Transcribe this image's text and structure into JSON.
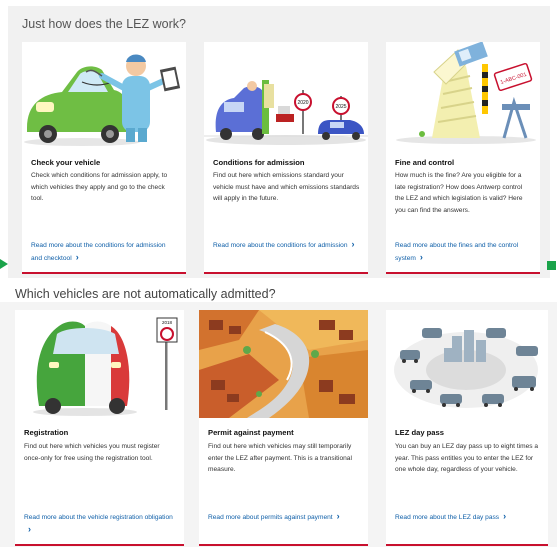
{
  "sections": {
    "work_heading": "Just how does the LEZ work?",
    "vehicles_heading": "Which vehicles are not automatically admitted?"
  },
  "cards_top": [
    {
      "title": "Check your vehicle",
      "description": "Check which conditions for admission apply, to which vehicles they apply and go to the check tool.",
      "link": "Read more about the conditions for admission and checktool",
      "image": "mechanic-inspecting-car-illustration"
    },
    {
      "title": "Conditions for admission",
      "description": "Find out here which emissions standard your vehicle must have and which emissions standards will apply in the future.",
      "link": "Read more about the conditions for admission",
      "image": "cars-passing-emission-signs-illustration",
      "signs": [
        "2020",
        "2025"
      ]
    },
    {
      "title": "Fine and control",
      "description": "How much is the fine? Are you eligible for a late registration? How does Antwerp control the LEZ and which legislation is valid? Here you can find the answers.",
      "link": "Read more about the fines and the control system",
      "image": "camera-scanning-papers-illustration",
      "plate": "1-ABC-001"
    }
  ],
  "cards_bottom": [
    {
      "title": "Registration",
      "description": "Find out here which vehicles you must register once-only for free using the registration tool.",
      "link": "Read more about the vehicle registration obligation",
      "image": "italian-flag-car-illustration",
      "sign": "2018"
    },
    {
      "title": "Permit against payment",
      "description": "Find out here which vehicles may still temporarily enter the LEZ after payment. This is a transitional measure.",
      "link": "Read more about permits against payment",
      "image": "city-blocks-aerial-illustration"
    },
    {
      "title": "LEZ day pass",
      "description": "You can buy an LEZ day pass up to eight times a year. This pass entitles you to enter the LEZ for one whole day, regardless of your vehicle.",
      "link": "Read more about the LEZ day pass",
      "image": "vehicles-circling-city-illustration"
    }
  ],
  "colors": {
    "link": "#0f5fa8",
    "card_accent": "#c8102e",
    "indicator": "#1aa34a"
  }
}
